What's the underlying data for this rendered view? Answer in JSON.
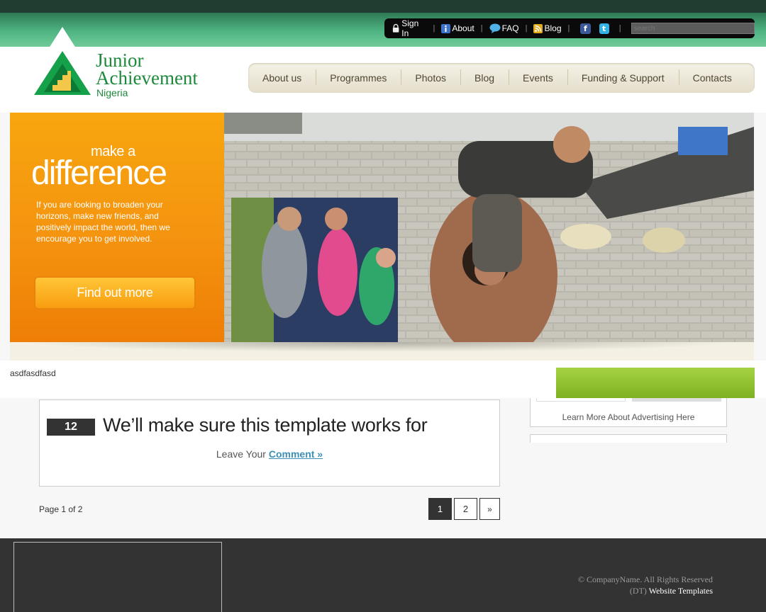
{
  "toplinks": {
    "signin": "Sign In",
    "about": "About",
    "faq": "FAQ",
    "blog": "Blog",
    "search_placeholder": "search",
    "icons": [
      "lock-icon",
      "info-icon",
      "speech-bubble-icon",
      "rss-icon",
      "facebook-icon",
      "twitter-icon"
    ]
  },
  "logo": {
    "line1": "Junior",
    "line2": "Achievement",
    "line3": "Nigeria"
  },
  "nav": {
    "items": [
      "About us",
      "Programmes",
      "Photos",
      "Blog",
      "Events",
      "Funding & Support",
      "Contacts"
    ]
  },
  "banner": {
    "make": "make a",
    "difference": "difference",
    "blurb": "If you are looking to broaden your horizons, make new friends, and positively impact the world, then we encourage you to get involved.",
    "button": "Find out more"
  },
  "caption": "asdfasdfasd",
  "sidebar": {
    "advertising": "Learn More About Advertising Here"
  },
  "post": {
    "day": "12",
    "title": "We’ll make sure this template works for",
    "comment_prefix": "Leave Your ",
    "comment_link": "Comment »"
  },
  "pagination": {
    "info": "Page 1 of 2",
    "pages": [
      "1",
      "2"
    ],
    "next": "»"
  },
  "footer": {
    "copyright": "© CompanyName. All Rights Reserved",
    "dt": "(DT)",
    "templates": "Website Templates"
  },
  "colors": {
    "brand_green": "#1d8a3b",
    "orange": "#f4930f",
    "accent_green": "#8fc232",
    "link_blue": "#3c8fb5",
    "footer_bg": "#333333"
  }
}
